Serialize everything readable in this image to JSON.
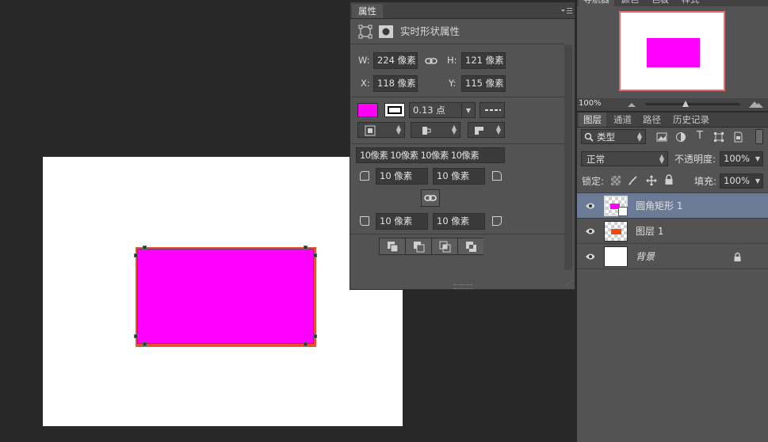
{
  "properties_panel": {
    "tab_label": "属性",
    "heading": "实时形状属性",
    "w_label": "W:",
    "w_value": "224 像素",
    "h_label": "H:",
    "h_value": "121 像素",
    "x_label": "X:",
    "x_value": "118 像素",
    "y_label": "Y:",
    "y_value": "115 像素",
    "fill_color": "#ff00ff",
    "stroke_width": "0.13 点",
    "corner_all": "10像素 10像素 10像素 10像素",
    "corner_tl": "10 像素",
    "corner_tr": "10 像素",
    "corner_bl": "10 像素",
    "corner_br": "10 像素"
  },
  "navigator": {
    "tabs": [
      "导航器",
      "颜色",
      "色板",
      "样式"
    ],
    "zoom": "100%"
  },
  "layers_panel": {
    "tabs": [
      "图层",
      "通道",
      "路径",
      "历史记录"
    ],
    "filter_kind": "类型",
    "blend_mode": "正常",
    "opacity_label": "不透明度:",
    "opacity_value": "100%",
    "lock_label": "锁定:",
    "fill_label": "填充:",
    "fill_value": "100%",
    "layers": [
      {
        "name": "圆角矩形 1",
        "selected": true
      },
      {
        "name": "图层 1",
        "selected": false
      },
      {
        "name": "背景",
        "selected": false,
        "locked": true
      }
    ]
  },
  "canvas": {
    "shape_fill": "#ff00ff",
    "shape_stroke": "#e8502a"
  }
}
